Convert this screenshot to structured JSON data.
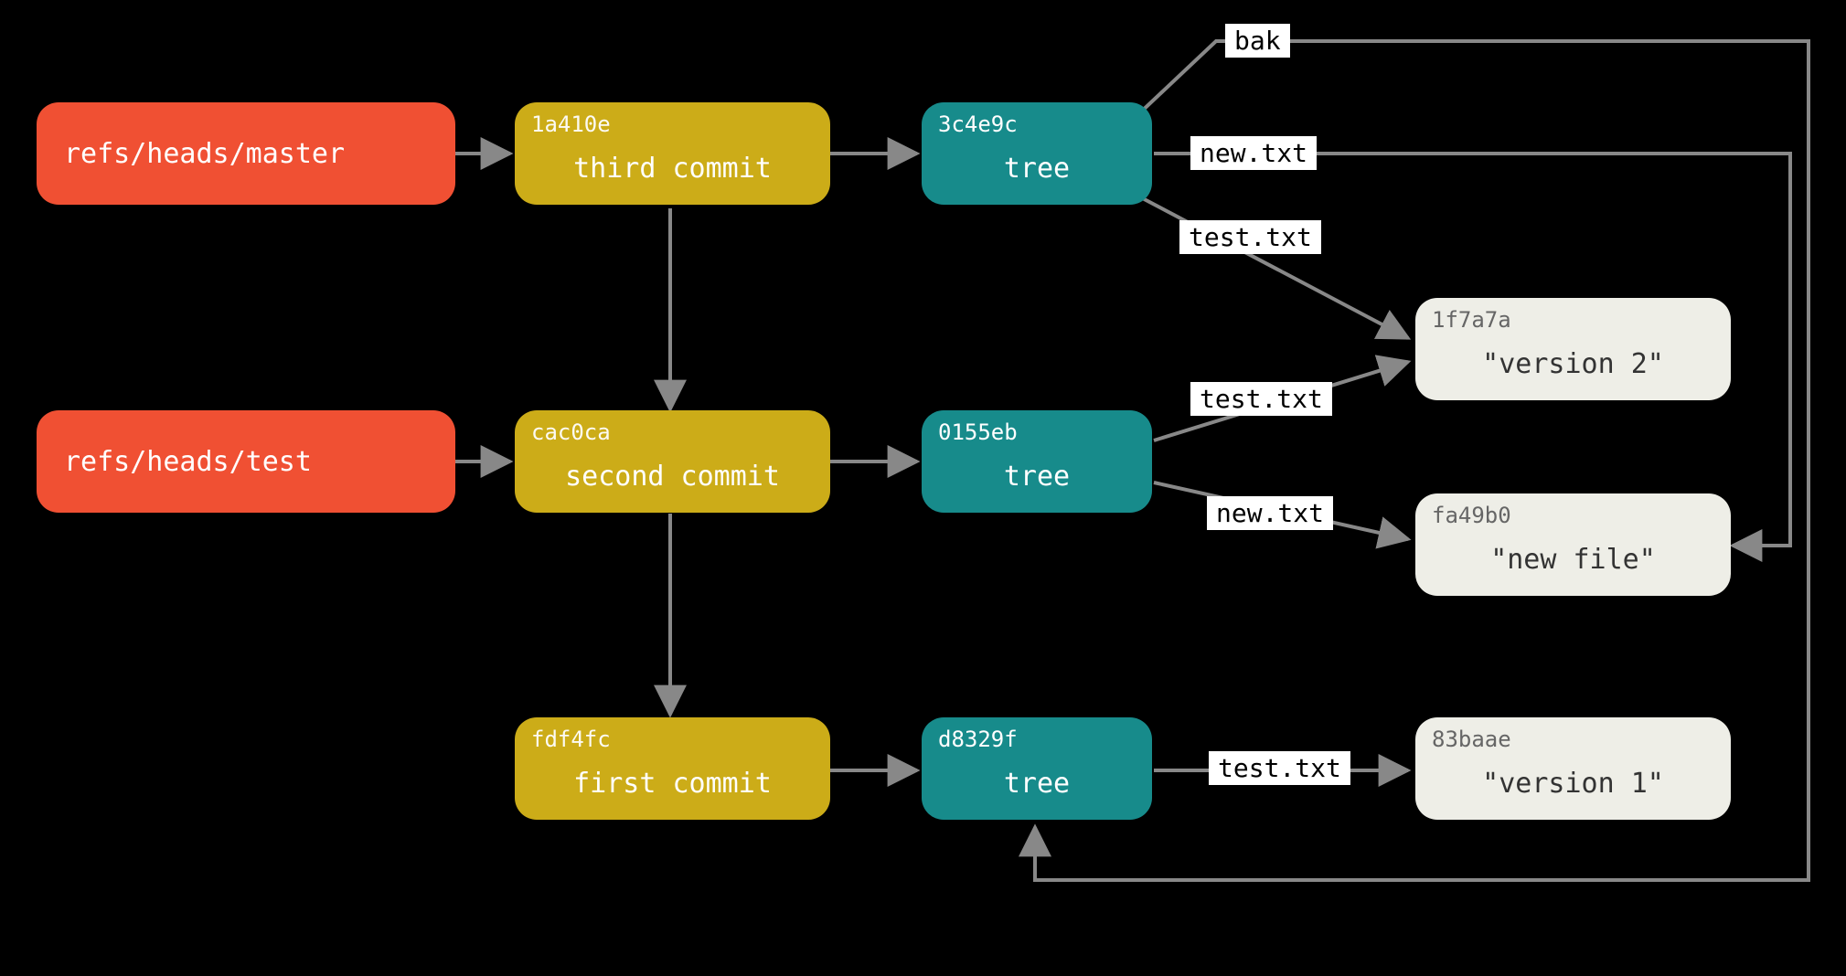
{
  "colors": {
    "ref": "#f05033",
    "commit": "#ccac18",
    "tree": "#178b8b",
    "blob": "#eeeee7",
    "bg": "#000000",
    "arrow": "#888888"
  },
  "refs": {
    "master": {
      "label": "refs/heads/master"
    },
    "test": {
      "label": "refs/heads/test"
    }
  },
  "commits": {
    "third": {
      "hash": "1a410e",
      "label": "third commit"
    },
    "second": {
      "hash": "cac0ca",
      "label": "second commit"
    },
    "first": {
      "hash": "fdf4fc",
      "label": "first commit"
    }
  },
  "trees": {
    "t3": {
      "hash": "3c4e9c",
      "label": "tree"
    },
    "t2": {
      "hash": "0155eb",
      "label": "tree"
    },
    "t1": {
      "hash": "d8329f",
      "label": "tree"
    }
  },
  "blobs": {
    "v2": {
      "hash": "1f7a7a",
      "label": "\"version 2\""
    },
    "newfile": {
      "hash": "fa49b0",
      "label": "\"new file\""
    },
    "v1": {
      "hash": "83baae",
      "label": "\"version 1\""
    }
  },
  "edgeLabels": {
    "t3_bak": "bak",
    "t3_newtxt": "new.txt",
    "t3_testtxt": "test.txt",
    "t2_testtxt": "test.txt",
    "t2_newtxt": "new.txt",
    "t1_testtxt": "test.txt"
  }
}
